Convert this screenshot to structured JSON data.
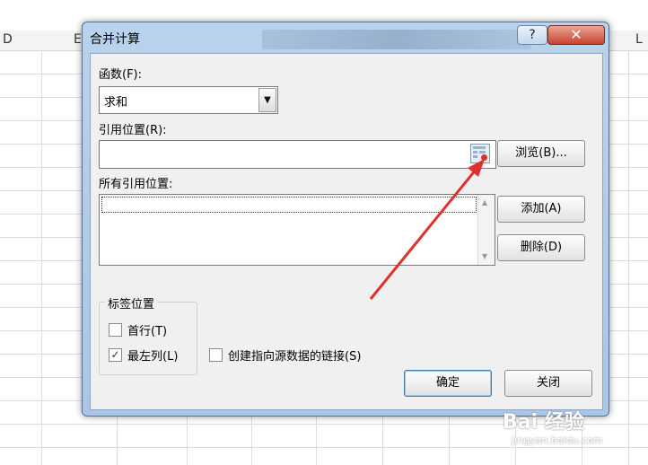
{
  "sheet": {
    "columns": [
      "D",
      "E",
      "L"
    ]
  },
  "dialog": {
    "title": "合并计算",
    "help_symbol": "?",
    "close_symbol": "✕",
    "function_label": "函数(F):",
    "function_value": "求和",
    "reference_label": "引用位置(R):",
    "reference_value": "",
    "all_references_label": "所有引用位置:",
    "browse_button": "浏览(B)...",
    "add_button": "添加(A)",
    "delete_button": "删除(D)",
    "label_position_title": "标签位置",
    "checkbox_top_row": {
      "label": "首行(T)",
      "checked": false
    },
    "checkbox_left_column": {
      "label": "最左列(L)",
      "checked": true
    },
    "checkbox_create_links": {
      "label": "创建指向源数据的链接(S)",
      "checked": false
    },
    "ok_button": "确定",
    "close_button": "关闭"
  },
  "annotation": {
    "arrow_color": "#e0302c"
  },
  "watermark": {
    "main": "Bai 经验",
    "sub": "jingyan.baidu.com"
  }
}
